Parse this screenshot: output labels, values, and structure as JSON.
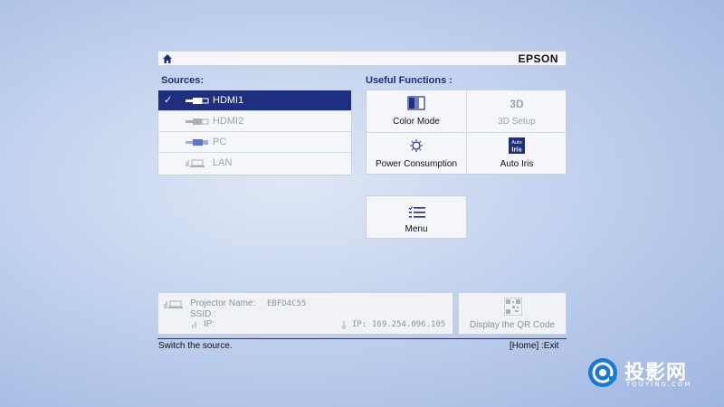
{
  "header": {
    "brand": "EPSON",
    "home_icon": "home-icon"
  },
  "sources": {
    "title": "Sources:",
    "items": [
      {
        "label": "HDMI1",
        "selected": true,
        "icon": "hdmi-connector-icon"
      },
      {
        "label": "HDMI2",
        "selected": false,
        "icon": "hdmi-connector-icon"
      },
      {
        "label": "PC",
        "selected": false,
        "icon": "vga-connector-icon"
      },
      {
        "label": "LAN",
        "selected": false,
        "icon": "lan-icon"
      }
    ],
    "check_mark": "✓"
  },
  "functions": {
    "title": "Useful Functions :",
    "items": [
      {
        "label": "Color Mode",
        "enabled": true,
        "icon": "color-mode-icon"
      },
      {
        "label": "3D Setup",
        "enabled": false,
        "icon": "3d-icon"
      },
      {
        "label": "Power Consumption",
        "enabled": true,
        "icon": "lightbulb-icon"
      },
      {
        "label": "Auto Iris",
        "enabled": true,
        "icon": "auto-iris-icon"
      }
    ],
    "auto_iris_icon_text": [
      "Auto",
      "Iris"
    ],
    "three_d_icon_text": "3D"
  },
  "menu": {
    "label": "Menu",
    "icon": "menu-list-icon"
  },
  "info": {
    "projector_name_label": "Projector Name:",
    "projector_name": "EBFD4C55",
    "ssid_label": "SSID :",
    "ip_label": "IP:",
    "wired_ip_label": "IP:",
    "wired_ip": "169.254.096.105"
  },
  "qr": {
    "label": "Display the QR Code",
    "icon": "qr-code-icon"
  },
  "status": {
    "left": "Switch the source.",
    "right": "[Home] :Exit"
  },
  "watermark": {
    "text": "投影网",
    "sub": "TOUYING.COM"
  },
  "colors": {
    "selected_bg": "#1f2f7f",
    "panel_bg": "#f4f6fa",
    "title_blue": "#1b2f77"
  }
}
